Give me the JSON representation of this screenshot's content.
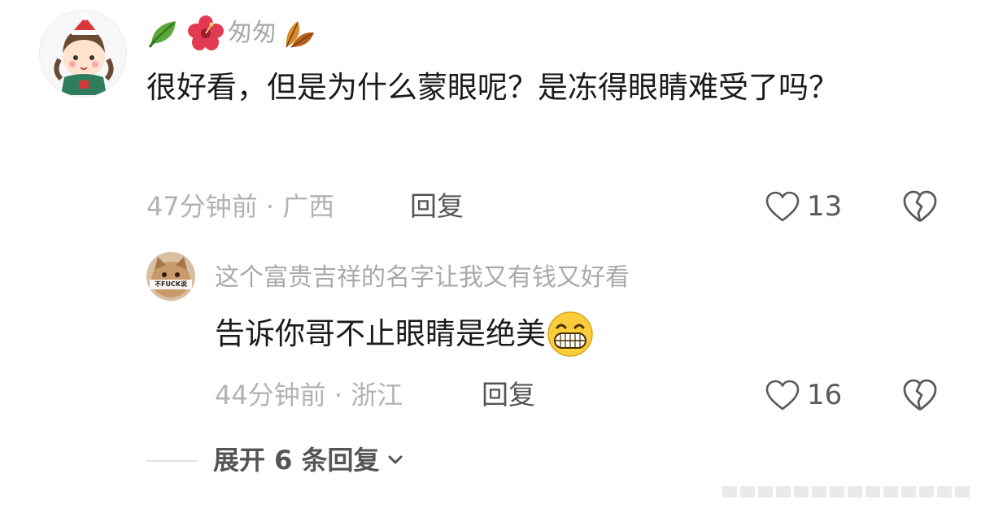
{
  "comment": {
    "username": "匆匆",
    "username_prefix_icons": [
      "leaf-icon",
      "hibiscus-icon"
    ],
    "username_suffix_icon": "autumn-leaf-icon",
    "text": "很好看，但是为什么蒙眼呢？是冻得眼睛难受了吗？",
    "meta": "47分钟前 · 广西",
    "reply_label": "回复",
    "like_count": "13"
  },
  "reply": {
    "username": "这个富贵吉祥的名字让我又有钱又好看",
    "text": "告诉你哥不止眼睛是绝美",
    "text_suffix_icon": "grin-emoji-icon",
    "avatar_text": "不FUCK说",
    "meta": "44分钟前 · 浙江",
    "reply_label": "回复",
    "like_count": "16"
  },
  "expand": {
    "label": "展开 6 条回复"
  }
}
